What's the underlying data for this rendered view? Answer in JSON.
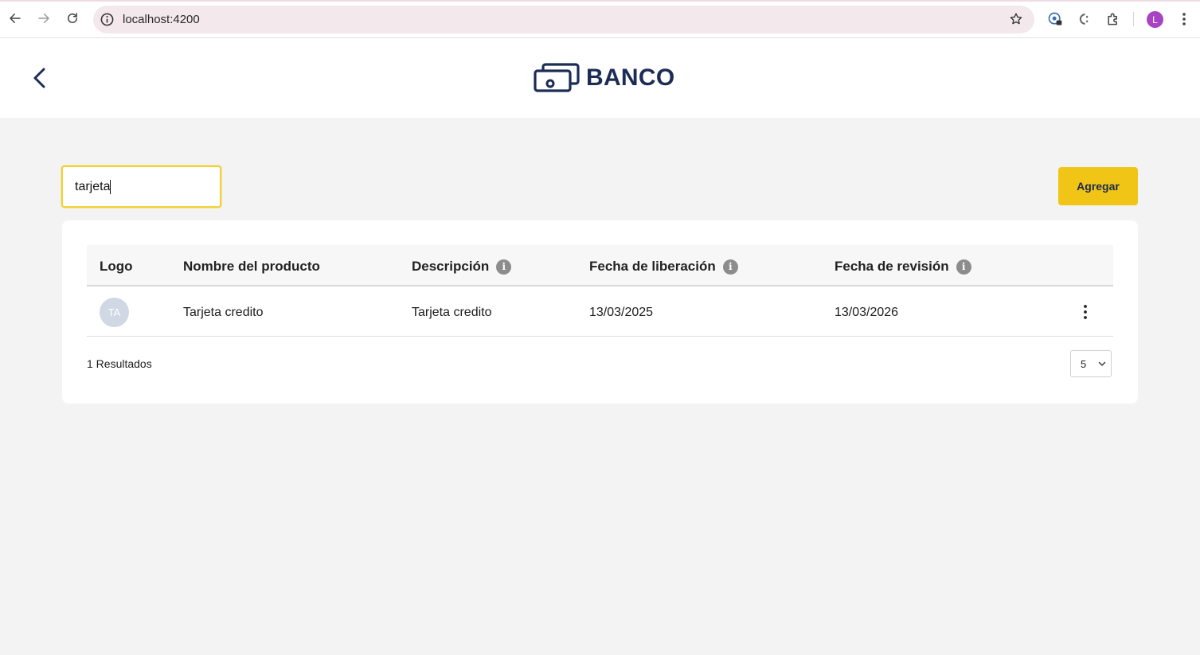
{
  "browser": {
    "url": "localhost:4200",
    "profile_initial": "L"
  },
  "header": {
    "brand": "BANCO",
    "brand_color": "#1c2c56"
  },
  "toolbar": {
    "search_value": "tarjeta",
    "add_label": "Agregar",
    "accent_color": "#f0c516"
  },
  "table": {
    "columns": {
      "logo": "Logo",
      "name": "Nombre del producto",
      "description": "Descripción",
      "release_date": "Fecha de liberación",
      "revision_date": "Fecha de revisión"
    },
    "info_glyph": "i",
    "rows": [
      {
        "logo_initials": "TA",
        "name": "Tarjeta credito",
        "description": "Tarjeta credito",
        "release_date": "13/03/2025",
        "revision_date": "13/03/2026"
      }
    ]
  },
  "footer": {
    "results_label": "1 Resultados",
    "page_size": "5"
  }
}
